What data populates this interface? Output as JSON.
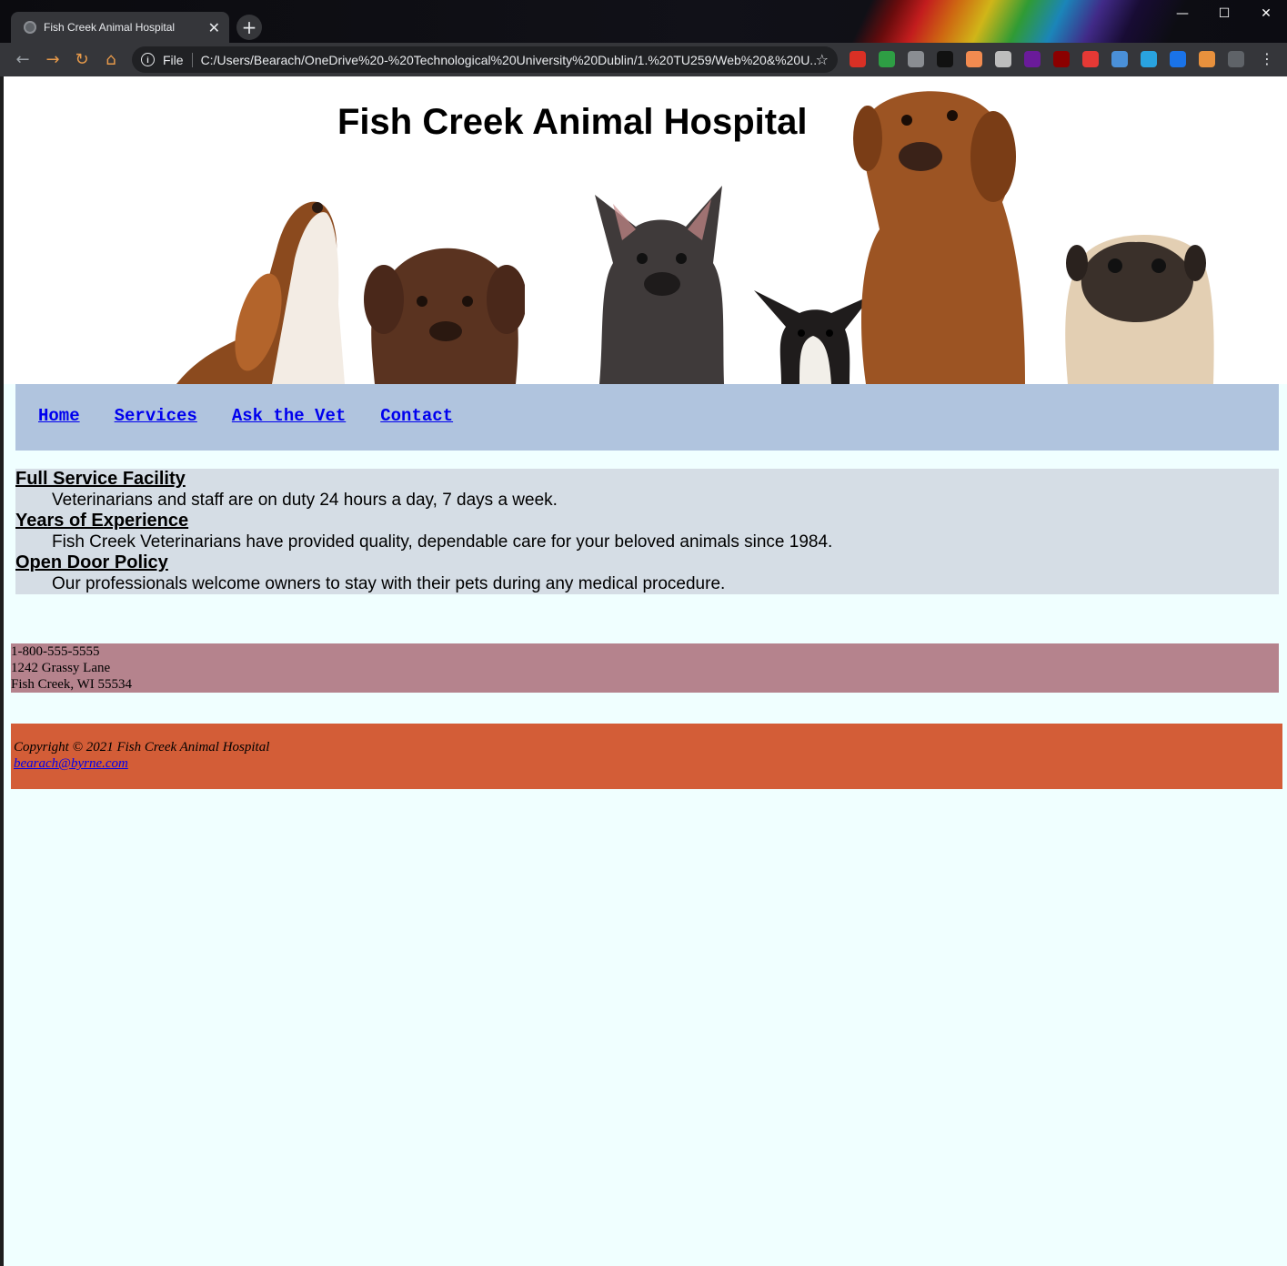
{
  "browser": {
    "tab_title": "Fish Creek Animal Hospital",
    "tab_close": "✕",
    "new_tab": "+",
    "scheme": "File",
    "url": "C:/Users/Bearach/OneDrive%20-%20Technological%20University%20Dublin/1.%20TU259/Web%20&%20U...",
    "window_controls": {
      "minimize": "—",
      "maximize": "☐",
      "close": "✕"
    },
    "extension_colors": [
      "#d93025",
      "#2e9e44",
      "#8a8d92",
      "#111111",
      "#f28b50",
      "#bdbdbd",
      "#6a1b9a",
      "#8b0000",
      "#e53935",
      "#4a90d9",
      "#29a3e0",
      "#1a73e8",
      "#e8913d",
      "#5f6368"
    ],
    "accent_nav_icon_color": "#e89a4a"
  },
  "site": {
    "title": "Fish Creek Animal Hospital",
    "nav": [
      "Home",
      "Services",
      "Ask the Vet",
      "Contact"
    ],
    "features": [
      {
        "term": "Full Service Facility",
        "desc": "Veterinarians and staff are on duty 24 hours a day, 7 days a week."
      },
      {
        "term": "Years of Experience",
        "desc": "Fish Creek Veterinarians have provided quality, dependable care for your beloved animals since 1984."
      },
      {
        "term": "Open Door Policy",
        "desc": "Our professionals welcome owners to stay with their pets during any medical procedure."
      }
    ],
    "contact": {
      "phone": "1-800-555-5555",
      "street": "1242 Grassy Lane",
      "city": "Fish Creek, WI 55534"
    },
    "footer": {
      "copyright": "Copyright © 2021 Fish Creek Animal Hospital",
      "email": "bearach@byrne.com"
    },
    "colors": {
      "page_bg": "#f0ffff",
      "nav_bg": "#b0c4de",
      "features_bg": "#d5dde5",
      "contact_bg": "#b5838d",
      "footer_bg": "#d35d37"
    }
  }
}
